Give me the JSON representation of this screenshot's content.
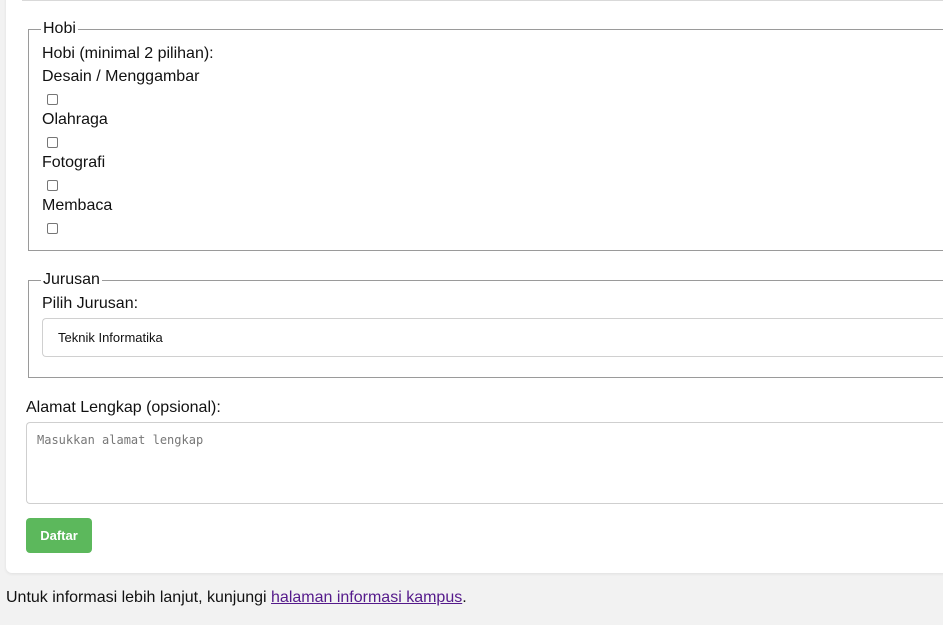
{
  "hobi": {
    "legend": "Hobi",
    "label": "Hobi (minimal 2 pilihan):",
    "options": [
      {
        "label": "Desain / Menggambar",
        "checked": false
      },
      {
        "label": "Olahraga",
        "checked": false
      },
      {
        "label": "Fotografi",
        "checked": false
      },
      {
        "label": "Membaca",
        "checked": false
      }
    ]
  },
  "jurusan": {
    "legend": "Jurusan",
    "label": "Pilih Jurusan:",
    "selected": "Teknik Informatika"
  },
  "alamat": {
    "label": "Alamat Lengkap (opsional):",
    "placeholder": "Masukkan alamat lengkap",
    "value": ""
  },
  "submit": {
    "label": "Daftar",
    "color": "#5cb85c"
  },
  "footer": {
    "text": "Untuk informasi lebih lanjut, kunjungi ",
    "link_text": "halaman informasi kampus",
    "suffix": "."
  }
}
